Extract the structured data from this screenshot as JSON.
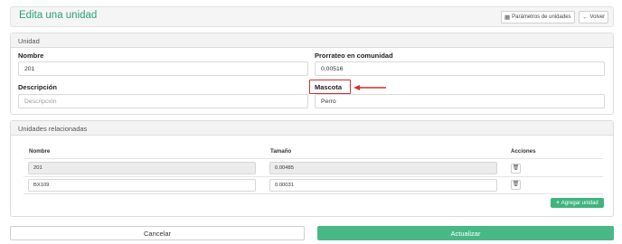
{
  "header": {
    "title": "Edita una unidad",
    "params_button": "Parámetros de unidades",
    "back_button": "Volver",
    "params_icon": "settings-square-icon",
    "back_icon": "arrow-left-icon"
  },
  "unit_panel": {
    "title": "Unidad",
    "nombre_label": "Nombre",
    "nombre_value": "201",
    "prorrateo_label": "Prorrateo en comunidad",
    "prorrateo_value": "0,00516",
    "descripcion_label": "Descripción",
    "descripcion_placeholder": "Descripción",
    "mascota_label": "Mascota",
    "mascota_value": "Perro"
  },
  "related_panel": {
    "title": "Unidades relacionadas",
    "columns": [
      "Nombre",
      "Tamaño",
      "Acciones"
    ],
    "rows": [
      {
        "nombre": "201",
        "tamano": "0.00485"
      },
      {
        "nombre": "BX109",
        "tamano": "0.00031"
      }
    ],
    "add_button": "Agregar unidad"
  },
  "footer": {
    "cancel": "Cancelar",
    "update": "Actualizar"
  },
  "colors": {
    "accent": "#2aa17b",
    "primary_button": "#48b887",
    "highlight": "#d32f2f"
  }
}
